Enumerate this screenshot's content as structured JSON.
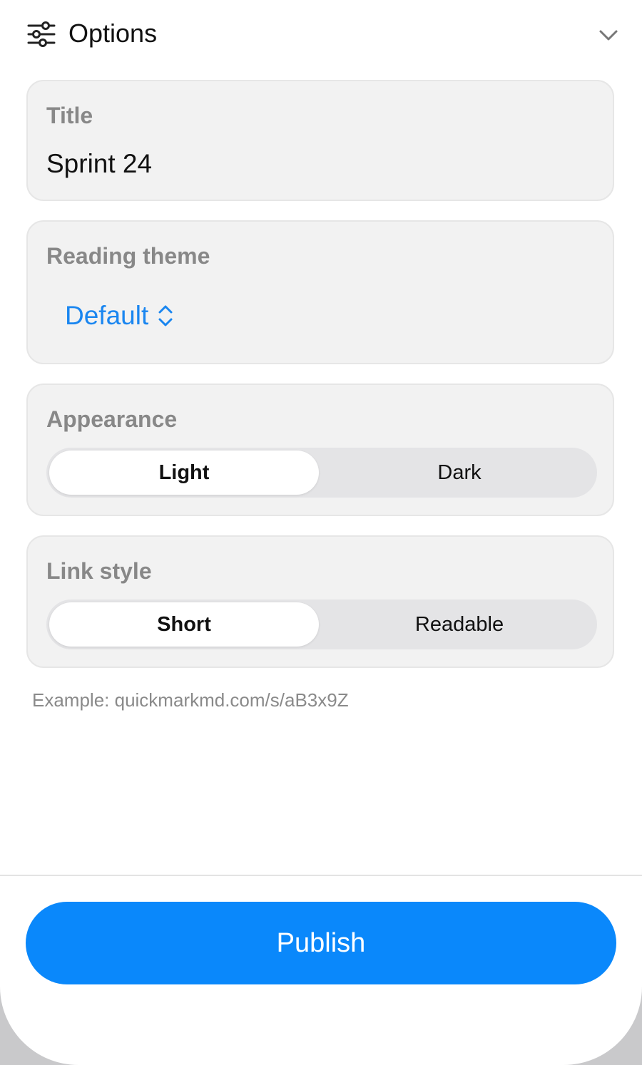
{
  "header": {
    "icon": "sliders-icon",
    "title": "Options",
    "toggle_icon": "chevron-down-icon"
  },
  "title_field": {
    "label": "Title",
    "value": "Sprint 24"
  },
  "reading_theme": {
    "label": "Reading theme",
    "selected": "Default",
    "icon": "chevron-up-down-icon"
  },
  "appearance": {
    "label": "Appearance",
    "options": [
      "Light",
      "Dark"
    ],
    "selected": "Light"
  },
  "link_style": {
    "label": "Link style",
    "options": [
      "Short",
      "Readable"
    ],
    "selected": "Short",
    "example": "Example: quickmarkmd.com/s/aB3x9Z"
  },
  "footer": {
    "publish_label": "Publish"
  },
  "colors": {
    "accent": "#0a88fb",
    "link": "#1a86f0",
    "card_bg": "#f2f2f2",
    "segment_bg": "#e4e4e6"
  }
}
